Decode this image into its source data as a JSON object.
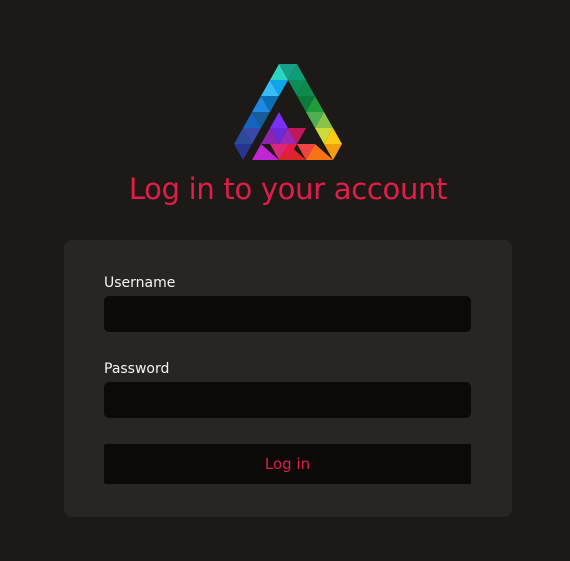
{
  "header": {
    "title": "Log in to your account",
    "logo_icon": "triangle-logo-icon"
  },
  "form": {
    "username_label": "Username",
    "username_value": "",
    "password_label": "Password",
    "password_value": "",
    "submit_label": "Log in"
  },
  "colors": {
    "background": "#1c1917",
    "card": "#292524",
    "input": "#0c0a09",
    "accent": "#e11d48",
    "text": "#f5f5f4"
  }
}
